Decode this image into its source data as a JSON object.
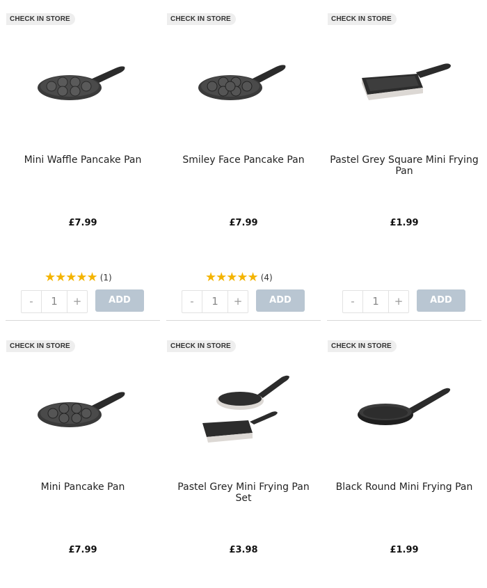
{
  "products": [
    {
      "badge": "CHECK IN STORE",
      "title": "Mini Waffle Pancake Pan",
      "price": "£7.99",
      "stars": "★★★★★",
      "review_count": "(1)",
      "quantity": "1",
      "minus": "-",
      "plus": "+",
      "add": "ADD",
      "image": "mini-waffle-pancake-pan"
    },
    {
      "badge": "CHECK IN STORE",
      "title": "Smiley Face Pancake Pan",
      "price": "£7.99",
      "stars": "★★★★★",
      "review_count": "(4)",
      "quantity": "1",
      "minus": "-",
      "plus": "+",
      "add": "ADD",
      "image": "smiley-face-pancake-pan"
    },
    {
      "badge": "CHECK IN STORE",
      "title": "Pastel Grey Square Mini Frying Pan",
      "price": "£1.99",
      "stars": "",
      "review_count": "",
      "quantity": "1",
      "minus": "-",
      "plus": "+",
      "add": "ADD",
      "image": "square-mini-frying-pan"
    },
    {
      "badge": "CHECK IN STORE",
      "title": "Mini Pancake Pan",
      "price": "£7.99",
      "image": "mini-pancake-pan"
    },
    {
      "badge": "CHECK IN STORE",
      "title": "Pastel Grey Mini Frying Pan Set",
      "price": "£3.98",
      "image": "mini-frying-pan-set"
    },
    {
      "badge": "CHECK IN STORE",
      "title": "Black Round Mini Frying Pan",
      "price": "£1.99",
      "image": "black-round-mini-frying-pan"
    }
  ],
  "colors": {
    "star": "#f4b400",
    "add_button": "#b9c6d2",
    "badge_bg": "#eeeeee",
    "pan_dark": "#3a3a3a",
    "pan_grey": "#d9d6d2"
  }
}
